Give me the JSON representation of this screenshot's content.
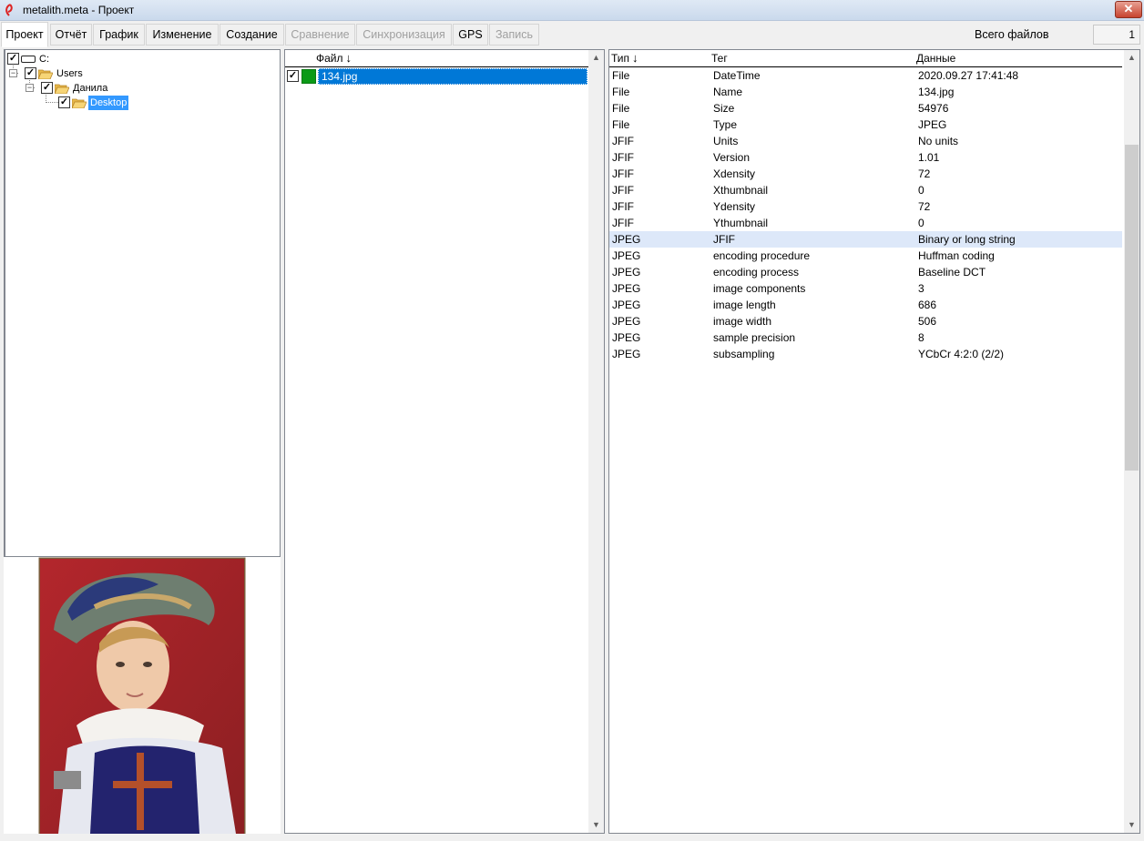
{
  "window": {
    "title": "metalith.meta - Проект",
    "close_label": "✕"
  },
  "tabs": [
    {
      "label": "Проект",
      "state": "active"
    },
    {
      "label": "Отчёт",
      "state": "normal"
    },
    {
      "label": "График",
      "state": "normal"
    },
    {
      "label": "Изменение",
      "state": "normal"
    },
    {
      "label": "Создание",
      "state": "normal"
    },
    {
      "label": "Сравнение",
      "state": "disabled"
    },
    {
      "label": "Синхронизация",
      "state": "disabled"
    },
    {
      "label": "GPS",
      "state": "normal"
    },
    {
      "label": "Запись",
      "state": "disabled"
    }
  ],
  "total_files": {
    "label": "Всего файлов",
    "value": "1"
  },
  "tree": {
    "drive": "C:",
    "users": "Users",
    "user": "Данила",
    "desktop": "Desktop"
  },
  "files": {
    "header_name": "Файл",
    "sort_arrow": "🠗",
    "rows": [
      {
        "name": "134.jpg",
        "checked": true,
        "color": "#0b9a17"
      }
    ]
  },
  "meta": {
    "headers": {
      "type": "Тип",
      "tag": "Тег",
      "data": "Данные"
    },
    "sort_arrow": "🠗",
    "rows": [
      {
        "type": "File",
        "tag": "DateTime",
        "data": "2020.09.27 17:41:48"
      },
      {
        "type": "File",
        "tag": "Name",
        "data": "134.jpg"
      },
      {
        "type": "File",
        "tag": "Size",
        "data": "54976"
      },
      {
        "type": "File",
        "tag": "Type",
        "data": "JPEG"
      },
      {
        "type": "JFIF",
        "tag": "Units",
        "data": "No units"
      },
      {
        "type": "JFIF",
        "tag": "Version",
        "data": "1.01"
      },
      {
        "type": "JFIF",
        "tag": "Xdensity",
        "data": "72"
      },
      {
        "type": "JFIF",
        "tag": "Xthumbnail",
        "data": "0"
      },
      {
        "type": "JFIF",
        "tag": "Ydensity",
        "data": "72"
      },
      {
        "type": "JFIF",
        "tag": "Ythumbnail",
        "data": "0"
      },
      {
        "type": "JPEG",
        "tag": "JFIF",
        "data": "Binary or long string"
      },
      {
        "type": "JPEG",
        "tag": "encoding procedure",
        "data": "Huffman coding"
      },
      {
        "type": "JPEG",
        "tag": "encoding process",
        "data": "Baseline DCT"
      },
      {
        "type": "JPEG",
        "tag": "image components",
        "data": "3"
      },
      {
        "type": "JPEG",
        "tag": "image length",
        "data": "686"
      },
      {
        "type": "JPEG",
        "tag": "image width",
        "data": "506"
      },
      {
        "type": "JPEG",
        "tag": "sample precision",
        "data": "8"
      },
      {
        "type": "JPEG",
        "tag": "subsampling",
        "data": "YCbCr 4:2:0 (2/2)"
      }
    ],
    "highlighted_row": 10
  },
  "colors": {
    "selection": "#0078d7",
    "row_highlight": "#dde8f9",
    "file_color": "#0b9a17"
  }
}
